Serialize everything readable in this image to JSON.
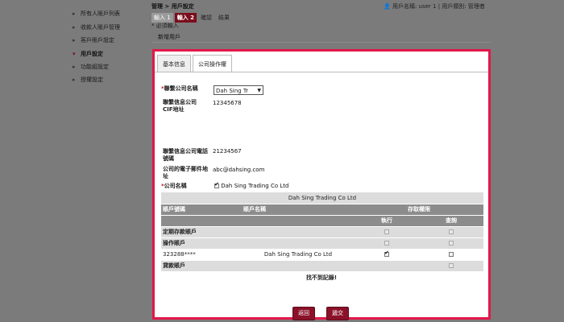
{
  "sidebar": {
    "items": [
      {
        "label": "所有人賬戶列表",
        "active": false
      },
      {
        "label": "收款人賬戶管理",
        "active": false
      },
      {
        "label": "客戶賬戶設定",
        "active": false
      },
      {
        "label": "用戶設定",
        "active": true
      },
      {
        "label": "功能組設定",
        "active": false
      },
      {
        "label": "授權設定",
        "active": false
      }
    ]
  },
  "header": {
    "breadcrumb": "管理 > 用戶設定",
    "username_label": "用戶名稱:",
    "username": "user 1",
    "usertype_label": "用戶類別:",
    "usertype": "管理者"
  },
  "steps": [
    "輸入 1",
    "輸入 2",
    "確認",
    "結果"
  ],
  "required_note": "* 必須輸入",
  "section_title": "新增用戶",
  "tabs": [
    "基本信息",
    "公司操作權"
  ],
  "form": {
    "company_name_label": "聯繫公司名稱",
    "company_select_value": "Dah Sing Tr",
    "cif_label": "聯繫信息公司 CIF地址",
    "cif_value": "12345678",
    "phone_label": "聯繫信息公司電話號碼",
    "phone_value": "21234567",
    "email_label": "公司的電子郵件地址",
    "email_value": "abc@dahsing.com",
    "company_label": "公司名稱",
    "company_checkbox_label": "Dah Sing Trading Co Ltd"
  },
  "table": {
    "title": "Dah Sing Trading Co Ltd",
    "col_account_no": "賬戶號碼",
    "col_account_name": "賬戶名稱",
    "col_access": "存取權限",
    "col_execute": "執行",
    "col_query": "查詢",
    "rows": [
      {
        "kind": "group",
        "label": "定期存款賬戶",
        "execute": "off",
        "query": "off"
      },
      {
        "kind": "group",
        "label": "操作賬戶",
        "execute": "off",
        "query": "off"
      },
      {
        "kind": "data",
        "label": "323288****",
        "name": "Dah Sing Trading Co Ltd",
        "execute": "on",
        "query": "off"
      },
      {
        "kind": "group",
        "label": "貸款賬戶",
        "execute": "",
        "query": "off"
      }
    ],
    "no_records": "找不到記錄!"
  },
  "buttons": {
    "back": "返回",
    "submit": "遞交"
  },
  "colors": {
    "accent": "#e3174a",
    "brand": "#7a0d1c",
    "button": "#8b1129"
  }
}
